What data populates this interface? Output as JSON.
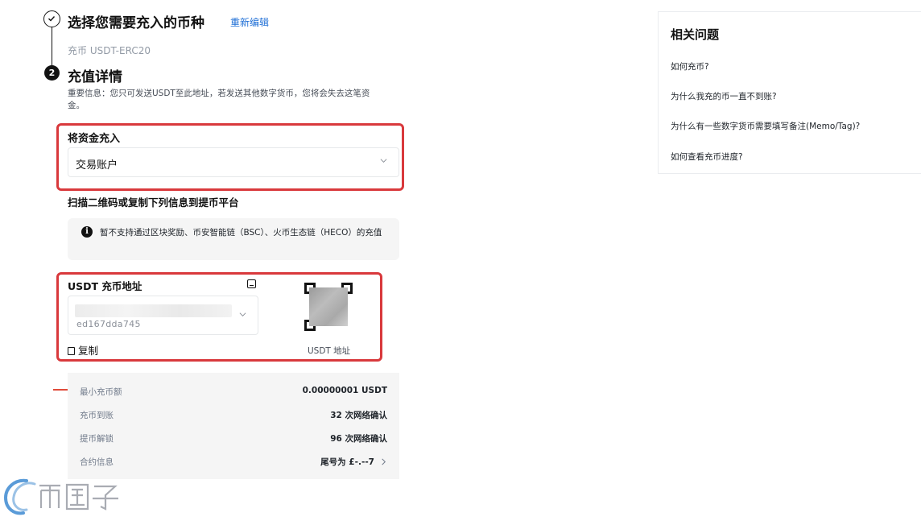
{
  "step1": {
    "title": "选择您需要充入的币种",
    "edit_label": "重新编辑",
    "selected": "充币 USDT-ERC20"
  },
  "step2": {
    "number": "2",
    "title": "充值详情",
    "notice": "重要信息：您只可发送USDT至此地址，若发送其他数字货币，您将会失去这笔资金。"
  },
  "fund": {
    "label": "将资金充入",
    "value": "交易账户"
  },
  "scan_label": "扫描二维码或复制下列信息到提币平台",
  "info": {
    "icon": "info-icon",
    "text": "暂不支持通过区块奖励、币安智能链（BSC）、火币生态链（HECO）的充值"
  },
  "address": {
    "label": "USDT 充币地址",
    "value_visible": "ed167dda745",
    "copy_label": "复制",
    "qr_caption": "USDT 地址"
  },
  "details": [
    {
      "key": "最小充币额",
      "value": "0.00000001 USDT"
    },
    {
      "key": "充币到账",
      "value": "32 次网络确认"
    },
    {
      "key": "提币解锁",
      "value": "96 次网络确认"
    },
    {
      "key": "合约信息",
      "value": "尾号为 £-.--7"
    }
  ],
  "faq": {
    "title": "相关问题",
    "items": [
      "如何充币?",
      "为什么我充的币一直不到账?",
      "为什么有一些数字货币需要填写备注(Memo/Tag)?",
      "如何查看充币进度?"
    ]
  },
  "watermark": {
    "text": "币圈子"
  },
  "colors": {
    "highlight": "#d9393c",
    "link": "#1f6fd6",
    "panel": "#f5f5f5"
  }
}
